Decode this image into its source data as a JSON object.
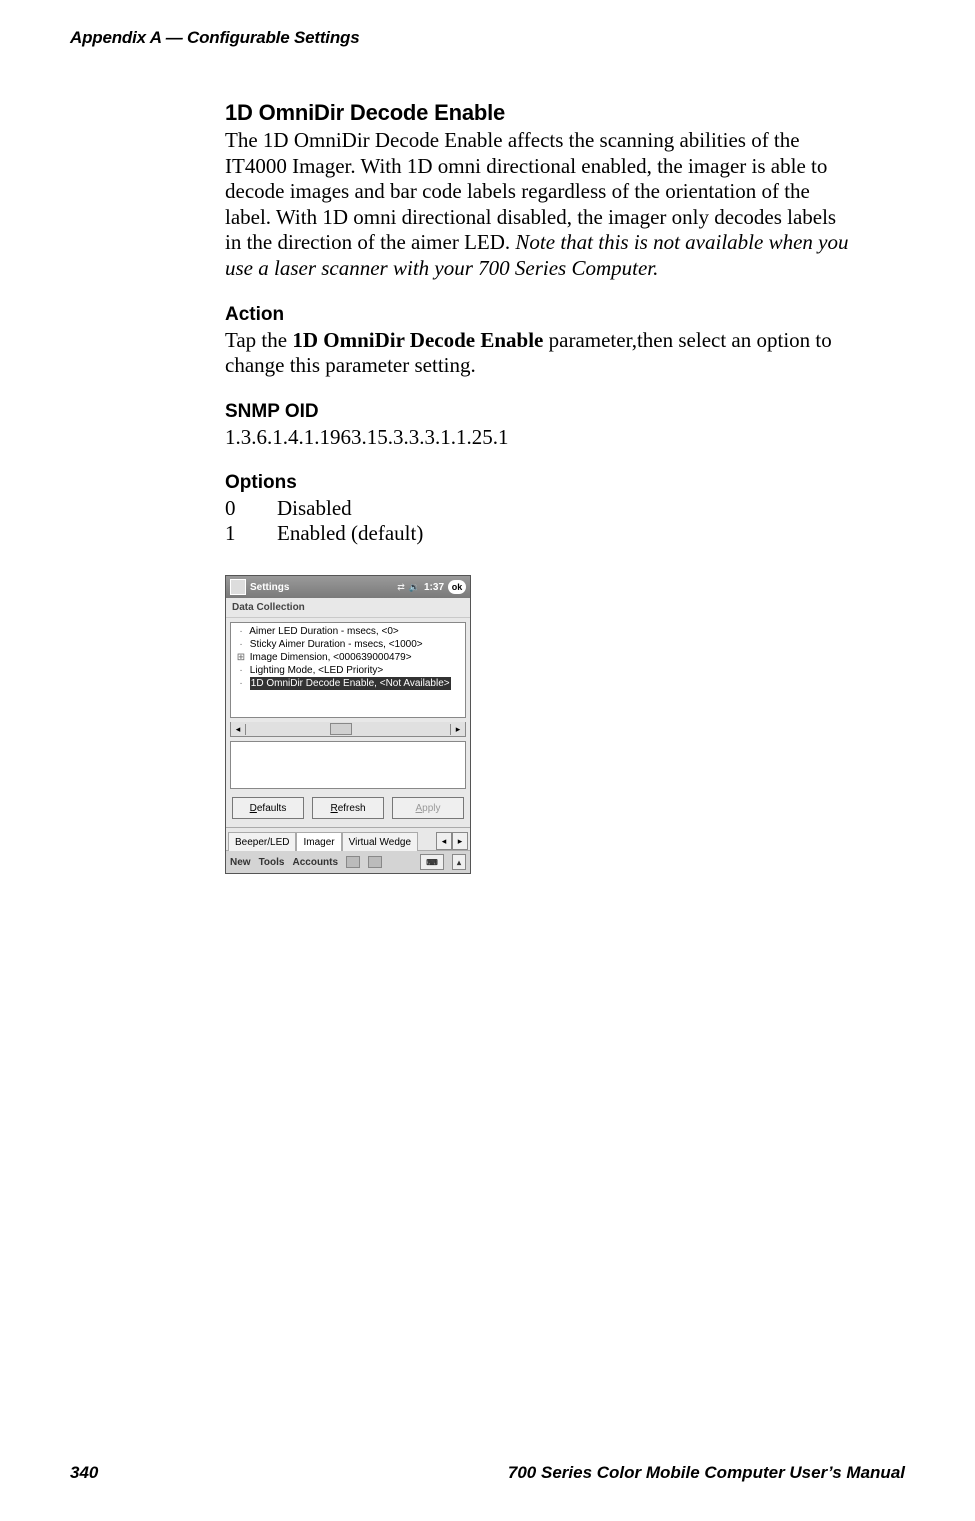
{
  "header": {
    "running_head": "Appendix A    —   Configurable Settings"
  },
  "section": {
    "title": "1D OmniDir Decode Enable",
    "para_plain": "The 1D OmniDir Decode Enable affects the scanning abilities of the IT4000 Imager. With 1D omni directional enabled, the imager is able to decode images and bar code labels regardless of the orientation of the label. With 1D omni directional disabled, the imager only decodes labels in the direction of the aimer LED. ",
    "para_italic": "Note that this is not available when you use a laser scanner with your 700 Series Computer."
  },
  "action": {
    "heading": "Action",
    "pre": "Tap the ",
    "bold": "1D OmniDir Decode Enable",
    "post": " parameter,then select an option to change this parameter setting."
  },
  "snmp": {
    "heading": "SNMP OID",
    "value": "1.3.6.1.4.1.1963.15.3.3.3.1.1.25.1"
  },
  "options": {
    "heading": "Options",
    "rows": [
      {
        "code": "0",
        "label": "Disabled"
      },
      {
        "code": "1",
        "label": "Enabled (default)"
      }
    ]
  },
  "screenshot": {
    "titlebar": {
      "title": "Settings",
      "time": "1:37",
      "ok": "ok"
    },
    "subtitle": "Data Collection",
    "tree": [
      "Aimer LED Duration - msecs, <0>",
      "Sticky Aimer Duration - msecs, <1000>",
      "Image Dimension, <000639000479>",
      "Lighting Mode, <LED Priority>",
      "1D OmniDir Decode Enable, <Not Available>"
    ],
    "buttons": {
      "defaults_accel": "D",
      "defaults_rest": "efaults",
      "refresh_accel": "R",
      "refresh_rest": "efresh",
      "apply_accel": "A",
      "apply_rest": "pply"
    },
    "tabs": {
      "items": [
        "Beeper/LED",
        "Imager",
        "Virtual Wedge"
      ],
      "active_index": 1
    },
    "bottombar": {
      "items": [
        "New",
        "Tools",
        "Accounts"
      ]
    }
  },
  "footer": {
    "page": "340",
    "book": "700 Series Color Mobile Computer User’s Manual"
  }
}
